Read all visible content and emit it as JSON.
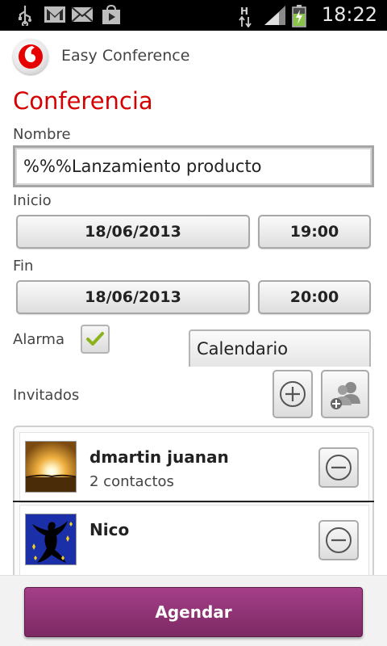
{
  "status_bar": {
    "time": "18:22",
    "icons": [
      "usb-icon",
      "gmail-icon",
      "email-icon",
      "play-store-icon",
      "hspa-icon",
      "signal-icon",
      "battery-charging-icon"
    ]
  },
  "app": {
    "title": "Easy Conference",
    "logo": "vodafone-logo"
  },
  "form": {
    "section_title": "Conferencia",
    "name_label": "Nombre",
    "name_value": "%%%Lanzamiento producto",
    "start_label": "Inicio",
    "start_date": "18/06/2013",
    "start_time": "19:00",
    "end_label": "Fin",
    "end_date": "18/06/2013",
    "end_time": "20:00",
    "alarm_label": "Alarma",
    "alarm_checked": true,
    "calendar_value": "Calendario",
    "guests_label": "Invitados",
    "add_icon": "add-circle-icon",
    "add_group_icon": "add-contacts-icon"
  },
  "guests": [
    {
      "name": "dmartin juanan",
      "sub": "2 contactos",
      "avatar": "sunset-avatar",
      "remove_icon": "remove-circle-icon"
    },
    {
      "name": "Nico",
      "sub": "",
      "avatar": "dancer-avatar",
      "remove_icon": "remove-circle-icon"
    }
  ],
  "footer": {
    "schedule_label": "Agendar"
  },
  "colors": {
    "accent_red": "#d50000",
    "primary_purple": "#8e3174",
    "status_bar": "#000000"
  }
}
